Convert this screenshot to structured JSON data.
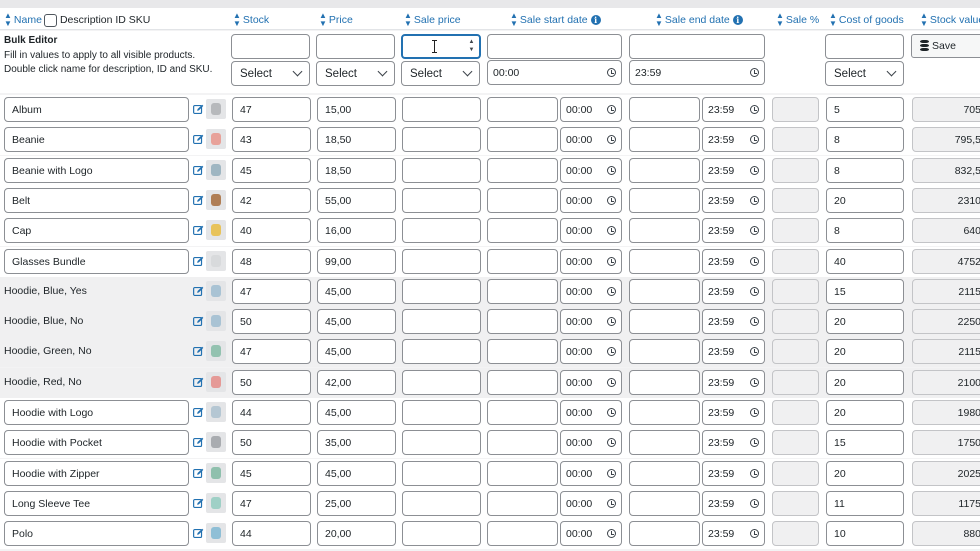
{
  "headers": {
    "name": "Name",
    "desc_id_sku": "Description ID SKU",
    "stock": "Stock",
    "price": "Price",
    "sale_price": "Sale price",
    "sale_start": "Sale start date",
    "sale_end": "Sale end date",
    "sale_pct": "Sale %",
    "cost": "Cost of goods",
    "stock_value": "Stock value"
  },
  "bulk": {
    "title": "Bulk Editor",
    "description": "Fill in values to apply to all visible products. Double click name for description, ID and SKU.",
    "select_label": "Select",
    "start_time": "00:00",
    "end_time": "23:59",
    "save_label": "Save"
  },
  "rows": [
    {
      "name": "Album",
      "boxed": true,
      "stock": "47",
      "price": "15,00",
      "start_time": "00:00",
      "end_time": "23:59",
      "cost": "5",
      "stock_value": "705",
      "thumb_color": "#b7b9bc"
    },
    {
      "name": "Beanie",
      "boxed": true,
      "stock": "43",
      "price": "18,50",
      "start_time": "00:00",
      "end_time": "23:59",
      "cost": "8",
      "stock_value": "795,5",
      "thumb_color": "#e8a29a"
    },
    {
      "name": "Beanie with Logo",
      "boxed": true,
      "stock": "45",
      "price": "18,50",
      "start_time": "00:00",
      "end_time": "23:59",
      "cost": "8",
      "stock_value": "832,5",
      "thumb_color": "#9fb6c2"
    },
    {
      "name": "Belt",
      "boxed": true,
      "stock": "42",
      "price": "55,00",
      "start_time": "00:00",
      "end_time": "23:59",
      "cost": "20",
      "stock_value": "2310",
      "thumb_color": "#b07e55"
    },
    {
      "name": "Cap",
      "boxed": true,
      "stock": "40",
      "price": "16,00",
      "start_time": "00:00",
      "end_time": "23:59",
      "cost": "8",
      "stock_value": "640",
      "thumb_color": "#e8c35a"
    },
    {
      "name": "Glasses Bundle",
      "boxed": true,
      "stock": "48",
      "price": "99,00",
      "start_time": "00:00",
      "end_time": "23:59",
      "cost": "40",
      "stock_value": "4752",
      "thumb_color": "#d8dadc"
    },
    {
      "name": "Hoodie, Blue, Yes",
      "boxed": false,
      "stock": "47",
      "price": "45,00",
      "start_time": "00:00",
      "end_time": "23:59",
      "cost": "15",
      "stock_value": "2115",
      "thumb_color": "#a9c3d4"
    },
    {
      "name": "Hoodie, Blue, No",
      "boxed": false,
      "stock": "50",
      "price": "45,00",
      "start_time": "00:00",
      "end_time": "23:59",
      "cost": "20",
      "stock_value": "2250",
      "thumb_color": "#a9c3d4"
    },
    {
      "name": "Hoodie, Green, No",
      "boxed": false,
      "stock": "47",
      "price": "45,00",
      "start_time": "00:00",
      "end_time": "23:59",
      "cost": "20",
      "stock_value": "2115",
      "thumb_color": "#93c2b0"
    },
    {
      "name": "Hoodie, Red, No",
      "boxed": false,
      "stock": "50",
      "price": "42,00",
      "start_time": "00:00",
      "end_time": "23:59",
      "cost": "20",
      "stock_value": "2100",
      "thumb_color": "#e59a97"
    },
    {
      "name": "Hoodie with Logo",
      "boxed": true,
      "stock": "44",
      "price": "45,00",
      "start_time": "00:00",
      "end_time": "23:59",
      "cost": "20",
      "stock_value": "1980",
      "thumb_color": "#b5c7d3"
    },
    {
      "name": "Hoodie with Pocket",
      "boxed": true,
      "stock": "50",
      "price": "35,00",
      "start_time": "00:00",
      "end_time": "23:59",
      "cost": "15",
      "stock_value": "1750",
      "thumb_color": "#a9acb0"
    },
    {
      "name": "Hoodie with Zipper",
      "boxed": true,
      "stock": "45",
      "price": "45,00",
      "start_time": "00:00",
      "end_time": "23:59",
      "cost": "20",
      "stock_value": "2025",
      "thumb_color": "#8fc0ad"
    },
    {
      "name": "Long Sleeve Tee",
      "boxed": true,
      "stock": "47",
      "price": "25,00",
      "start_time": "00:00",
      "end_time": "23:59",
      "cost": "11",
      "stock_value": "1175",
      "thumb_color": "#9fd0c6"
    },
    {
      "name": "Polo",
      "boxed": true,
      "stock": "44",
      "price": "20,00",
      "start_time": "00:00",
      "end_time": "23:59",
      "cost": "10",
      "stock_value": "880",
      "thumb_color": "#8fbfd6"
    }
  ],
  "colors": {
    "link_blue": "#2271b1",
    "row_alt": "#f0f0f1"
  }
}
